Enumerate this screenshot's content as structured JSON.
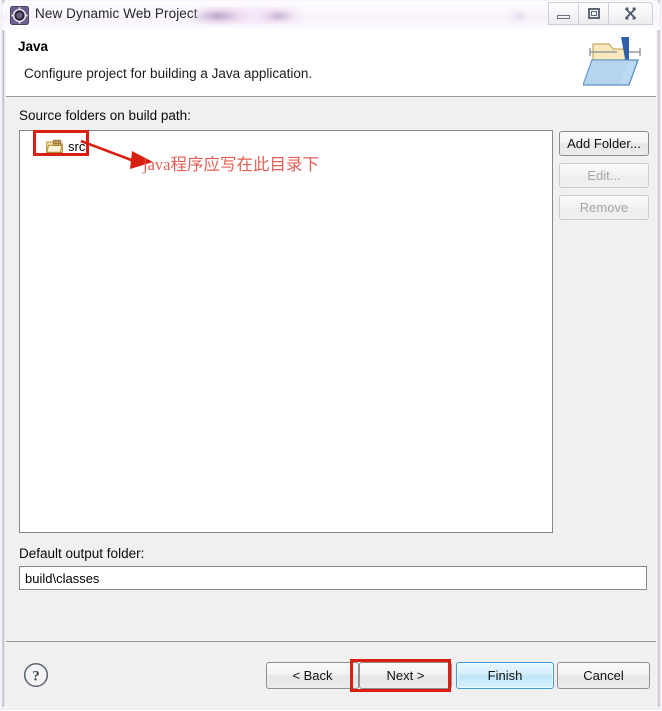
{
  "window": {
    "title": "New Dynamic Web Project",
    "icon": "eclipse-wizard-icon",
    "redacted_suffix": "",
    "controls": {
      "minimize": "Minimize",
      "maximize": "Restore",
      "close": "Close"
    }
  },
  "header": {
    "title": "Java",
    "description": "Configure project for building a Java application.",
    "icon": "java-folder-icon"
  },
  "main": {
    "source_folders_label": "Source folders on build path:",
    "source_folders": [
      {
        "name": "src",
        "icon": "source-folder-icon"
      }
    ],
    "side_buttons": [
      {
        "id": "add-folder",
        "label": "Add Folder...",
        "enabled": true
      },
      {
        "id": "edit",
        "label": "Edit...",
        "enabled": false
      },
      {
        "id": "remove",
        "label": "Remove",
        "enabled": false
      }
    ],
    "output_folder_label": "Default output folder:",
    "output_folder_value": "build\\classes",
    "output_folder_placeholder": "build\\classes"
  },
  "footer": {
    "help_icon": "help-question-icon",
    "buttons": [
      {
        "id": "back",
        "label": "< Back",
        "default": false
      },
      {
        "id": "next",
        "label": "Next >",
        "default": false
      },
      {
        "id": "finish",
        "label": "Finish",
        "default": true
      },
      {
        "id": "cancel",
        "label": "Cancel",
        "default": false
      }
    ]
  },
  "annotations": {
    "color": "#d91f11",
    "text_color": "#e35f55",
    "src_note": "java程序应写在此目录下",
    "highlighted": [
      "src-list-item",
      "next-button"
    ]
  }
}
